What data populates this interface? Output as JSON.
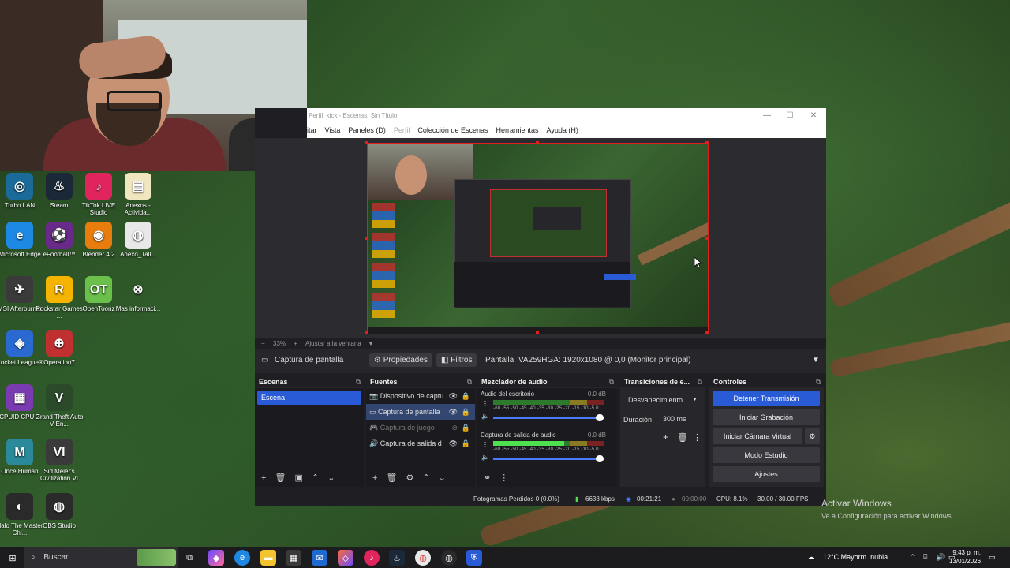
{
  "desktop": {
    "icons": [
      {
        "label": "Turbo LAN",
        "icon": "turbo-lan-icon",
        "color": "#1a6a9a",
        "glyph": "◎"
      },
      {
        "label": "Steam",
        "icon": "steam-icon",
        "color": "#1b2838",
        "glyph": "♨"
      },
      {
        "label": "TikTok LIVE Studio",
        "icon": "tiktok-icon",
        "color": "#e0245e",
        "glyph": "♪"
      },
      {
        "label": "Anexos - Activida...",
        "icon": "document-icon",
        "color": "#f0e6c0",
        "glyph": "▤"
      },
      {
        "label": "Microsoft Edge",
        "icon": "edge-icon",
        "color": "#1e88e5",
        "glyph": "e"
      },
      {
        "label": "eFootball™",
        "icon": "efootball-icon",
        "color": "#6a2a8a",
        "glyph": "⚽"
      },
      {
        "label": "Blender 4.2",
        "icon": "blender-icon",
        "color": "#e87d0d",
        "glyph": "◉"
      },
      {
        "label": "Anexo_Tall...",
        "icon": "chrome-doc-icon",
        "color": "#e8e8e8",
        "glyph": "◍"
      },
      {
        "label": "MSI Afterburner",
        "icon": "msi-afterburner-icon",
        "color": "#3a3a3a",
        "glyph": "✈"
      },
      {
        "label": "Rockstar Games ...",
        "icon": "rockstar-icon",
        "color": "#f4b400",
        "glyph": "R"
      },
      {
        "label": "OpenToonz",
        "icon": "opentoonz-icon",
        "color": "#6ac04a",
        "glyph": "OT"
      },
      {
        "label": "Mas informaci...",
        "icon": "info-icon",
        "color": "transparent",
        "glyph": "⊗"
      },
      {
        "label": "Rocket League®",
        "icon": "rocket-league-icon",
        "color": "#2a6ad0",
        "glyph": "◈"
      },
      {
        "label": "Operation7",
        "icon": "operation7-icon",
        "color": "#c03030",
        "glyph": "⊕"
      },
      {
        "label": "CPUID CPU-Z",
        "icon": "cpuz-icon",
        "color": "#7a3ab0",
        "glyph": "▦"
      },
      {
        "label": "Grand Theft Auto V En...",
        "icon": "gta-icon",
        "color": "#2a4a2a",
        "glyph": "V"
      },
      {
        "label": "Once Human",
        "icon": "once-human-icon",
        "color": "#2a8a9a",
        "glyph": "M"
      },
      {
        "label": "Sid Meier's Civilization VI",
        "icon": "civilization-icon",
        "color": "#3a3a3a",
        "glyph": "VI"
      },
      {
        "label": "Halo The Master Chi...",
        "icon": "halo-icon",
        "color": "#2a2a2a",
        "glyph": "◐"
      },
      {
        "label": "OBS Studio",
        "icon": "obs-icon",
        "color": "#2a2a2a",
        "glyph": "◍"
      }
    ]
  },
  "obs": {
    "title": "Perfil: kick - Escenas: Sin Título",
    "menu": [
      "itar",
      "Vista",
      "Paneles (D)",
      "Perfil",
      "Colección de Escenas",
      "Herramientas",
      "Ayuda (H)"
    ],
    "zoom": "33%",
    "fit_label": "Ajustar a la ventana",
    "source_name": "Captura de pantalla",
    "properties_label": "Propiedades",
    "filters_label": "Filtros",
    "screen_label": "Pantalla",
    "screen_value": "VA259HGA: 1920x1080 @ 0,0 (Monitor principal)",
    "scenes": {
      "title": "Escenas",
      "items": [
        "Escena"
      ]
    },
    "sources": {
      "title": "Fuentes",
      "items": [
        {
          "name": "Dispositivo de captu",
          "icon": "camera-icon",
          "selected": false,
          "disabled": false
        },
        {
          "name": "Captura de pantalla",
          "icon": "monitor-icon",
          "selected": true,
          "disabled": false
        },
        {
          "name": "Captura de juego",
          "icon": "gamepad-icon",
          "selected": false,
          "disabled": true
        },
        {
          "name": "Captura de salida d",
          "icon": "speaker-icon",
          "selected": false,
          "disabled": false
        }
      ]
    },
    "mixer": {
      "title": "Mezclador de audio",
      "scale": "-60 -55 -50 -45 -40 -35 -30 -25 -20 -15 -10 -5 0",
      "channels": [
        {
          "name": "Audio del escritorio",
          "db": "0.0 dB",
          "level": 0.0
        },
        {
          "name": "Captura de salida de audio",
          "db": "0.0 dB",
          "level": 0.64
        }
      ]
    },
    "transitions": {
      "title": "Transiciones de e...",
      "selected": "Desvanecimiento",
      "duration_label": "Duración",
      "duration_value": "300 ms"
    },
    "controls": {
      "title": "Controles",
      "buttons": [
        "Detener Transmisión",
        "Iniciar Grabación",
        "Iniciar Cámara Virtual",
        "Modo Estudio",
        "Ajustes"
      ]
    },
    "status": {
      "dropped": "Fotogramas Perdidos 0 (0.0%)",
      "bitrate": "6638 kbps",
      "stream_time": "00:21:21",
      "rec_time": "00:00:00",
      "cpu": "CPU: 8.1%",
      "fps": "30.00 / 30.00 FPS"
    }
  },
  "watermark": {
    "line1": "Activar Windows",
    "line2": "Ve a Configuración para activar Windows."
  },
  "taskbar": {
    "search_placeholder": "Buscar",
    "weather": "12°C  Mayorm. nubla...",
    "time": "9:43 p. m.",
    "date": "13/01/2026"
  }
}
